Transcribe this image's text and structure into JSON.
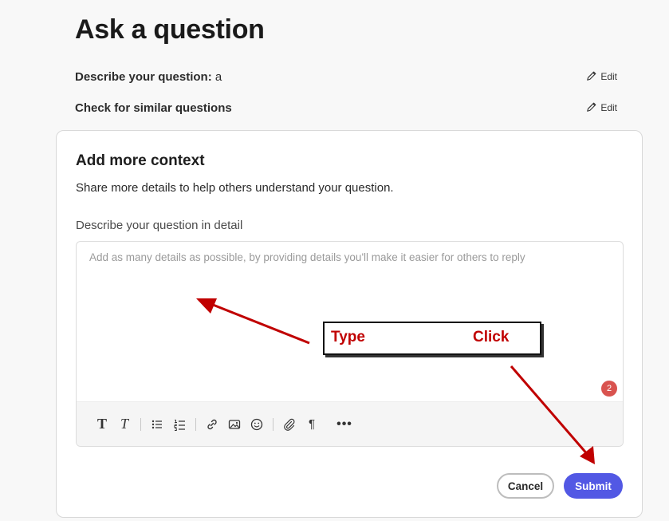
{
  "page": {
    "title": "Ask a question"
  },
  "steps": [
    {
      "label": "Describe your question:",
      "value": "a",
      "edit_label": "Edit"
    },
    {
      "label": "Check for similar questions",
      "value": "",
      "edit_label": "Edit"
    }
  ],
  "context_card": {
    "title": "Add more context",
    "subtitle": "Share more details to help others understand your question.",
    "field_label": "Describe your question in detail",
    "editor_placeholder": "Add as many details as possible, by providing details you'll make it easier for others to reply",
    "badge_count": "2",
    "toolbar": [
      "bold-icon",
      "italic-icon",
      "bullet-list-icon",
      "numbered-list-icon",
      "link-icon",
      "image-icon",
      "emoji-icon",
      "attachment-icon",
      "paragraph-icon",
      "more-icon"
    ],
    "cancel_label": "Cancel",
    "submit_label": "Submit"
  },
  "annotation": {
    "type_label": "Type",
    "click_label": "Click",
    "color": "#c00000"
  },
  "colors": {
    "submit_bg": "#5258e4",
    "badge_bg": "#d9534f",
    "arrow": "#c00000"
  }
}
